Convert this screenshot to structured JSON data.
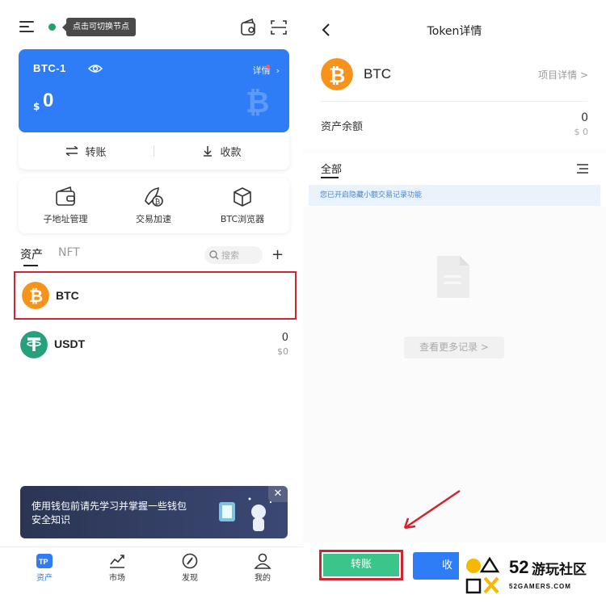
{
  "left": {
    "node_tooltip": "点击可切换节点",
    "wallet": {
      "name": "BTC-1",
      "detail_label": "详情",
      "currency_symbol": "$",
      "balance": "0"
    },
    "actions": {
      "transfer": "转账",
      "receive": "收款"
    },
    "tools": [
      {
        "label": "子地址管理"
      },
      {
        "label": "交易加速"
      },
      {
        "label": "BTC浏览器"
      }
    ],
    "tabs": {
      "assets": "资产",
      "nft": "NFT"
    },
    "search": {
      "placeholder": "搜索"
    },
    "assets": [
      {
        "symbol": "BTC"
      },
      {
        "symbol": "USDT",
        "amount": "0",
        "fiat": "$0"
      }
    ],
    "banner": {
      "text": "使用钱包前请先学习并掌握一些钱包安全知识"
    },
    "tabbar": [
      {
        "label": "资产"
      },
      {
        "label": "市场"
      },
      {
        "label": "发现"
      },
      {
        "label": "我的"
      }
    ]
  },
  "right": {
    "title": "Token详情",
    "coin_name": "BTC",
    "project_detail": "项目详情 >",
    "balance_label": "资产余额",
    "balance_value": "0",
    "balance_fiat": "$ 0",
    "filter_all": "全部",
    "notice": "您已开启隐藏小额交易记录功能",
    "more_records": "查看更多记录 >",
    "transfer_button": "转账",
    "receive_button": "收"
  },
  "watermark": {
    "number": "52",
    "name": "游玩社区",
    "domain": "52GAMERS.COM"
  },
  "colors": {
    "primary_blue": "#2f7df6",
    "btc_orange": "#f7931a",
    "usdt_green": "#26a17b",
    "highlight_red": "#d0252f",
    "transfer_green": "#3cc58a"
  }
}
